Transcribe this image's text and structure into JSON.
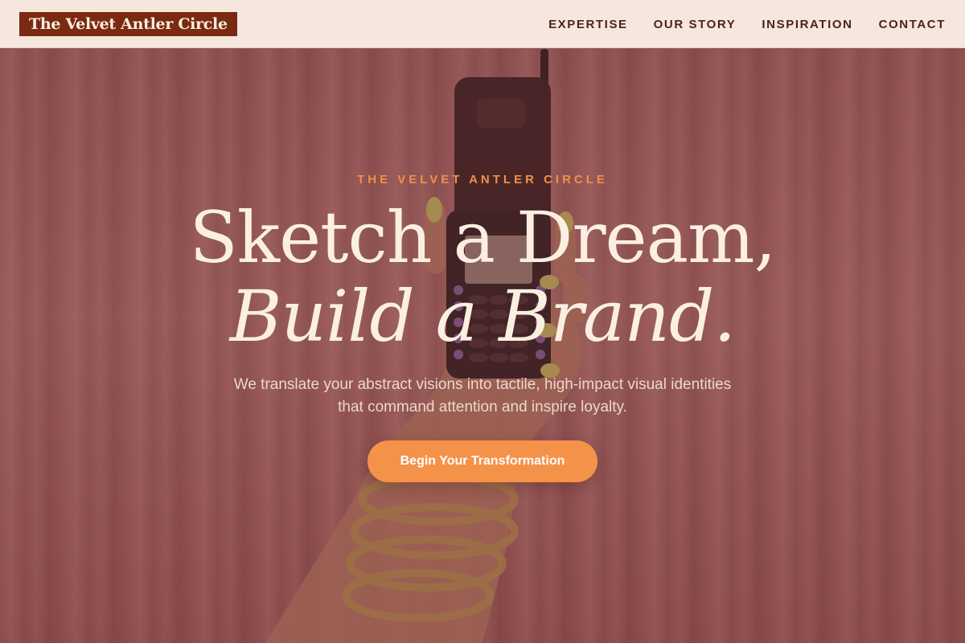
{
  "header": {
    "logo_text": "The Velvet Antler Circle",
    "nav": [
      {
        "label": "EXPERTISE"
      },
      {
        "label": "OUR STORY"
      },
      {
        "label": "INSPIRATION"
      },
      {
        "label": "CONTACT"
      }
    ]
  },
  "hero": {
    "eyebrow": "THE VELVET ANTLER CIRCLE",
    "headline_line1": "Sketch a Dream,",
    "headline_line2": "Build a Brand.",
    "subtitle": "We translate your abstract visions into tactile, high-impact visual identities that command attention and inspire loyalty.",
    "cta_label": "Begin Your Transformation",
    "image_subject": "hand holding a bejeweled flip phone with gold chain bracelets in front of pink curtains"
  },
  "colors": {
    "header_bg": "#f5e6de",
    "logo_bg": "#7a2a10",
    "nav_text": "#4a2418",
    "eyebrow": "#f2904a",
    "headline": "#fbefe2",
    "cta_bg": "#f5924a"
  }
}
